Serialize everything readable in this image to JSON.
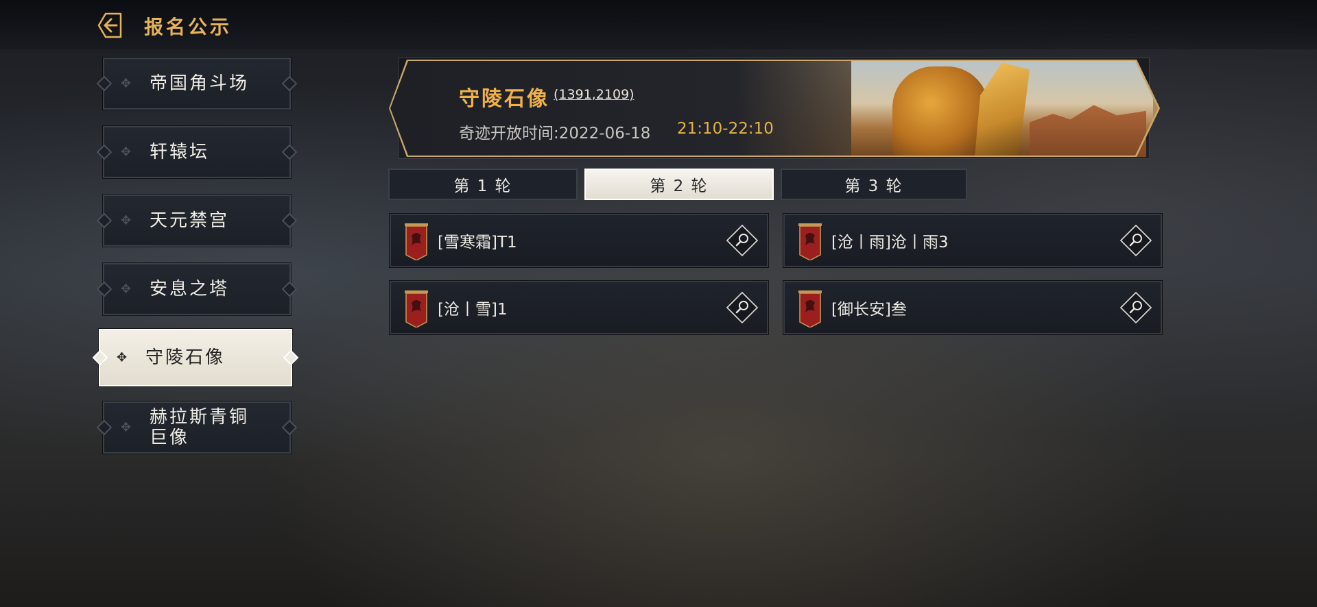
{
  "header": {
    "title": "报名公示",
    "back_icon": "back-arrow-icon"
  },
  "sidebar": {
    "items": [
      {
        "label": "帝国角斗场",
        "active": false
      },
      {
        "label": "轩辕坛",
        "active": false
      },
      {
        "label": "天元禁宫",
        "active": false
      },
      {
        "label": "安息之塔",
        "active": false
      },
      {
        "label": "守陵石像",
        "active": true
      },
      {
        "label": "赫拉斯青铜巨像",
        "active": false
      }
    ],
    "bullet": "✥"
  },
  "banner": {
    "title": "守陵石像",
    "coords": "(1391,2109)",
    "time_label": "奇迹开放时间:2022-06-18",
    "time_range": "21:10-22:10"
  },
  "tabs": [
    {
      "label": "第 1 轮",
      "active": false
    },
    {
      "label": "第 2 轮",
      "active": true
    },
    {
      "label": "第 3 轮",
      "active": false
    }
  ],
  "guilds": [
    {
      "name": "[雪寒霜]T1"
    },
    {
      "name": "[沧丨雨]沧丨雨3"
    },
    {
      "name": "[沧丨雪]1"
    },
    {
      "name": "[御长安]叁"
    }
  ],
  "colors": {
    "accent_gold": "#e6b25a",
    "time_gold": "#e7b443",
    "banner_red": "#9b1f1f"
  }
}
